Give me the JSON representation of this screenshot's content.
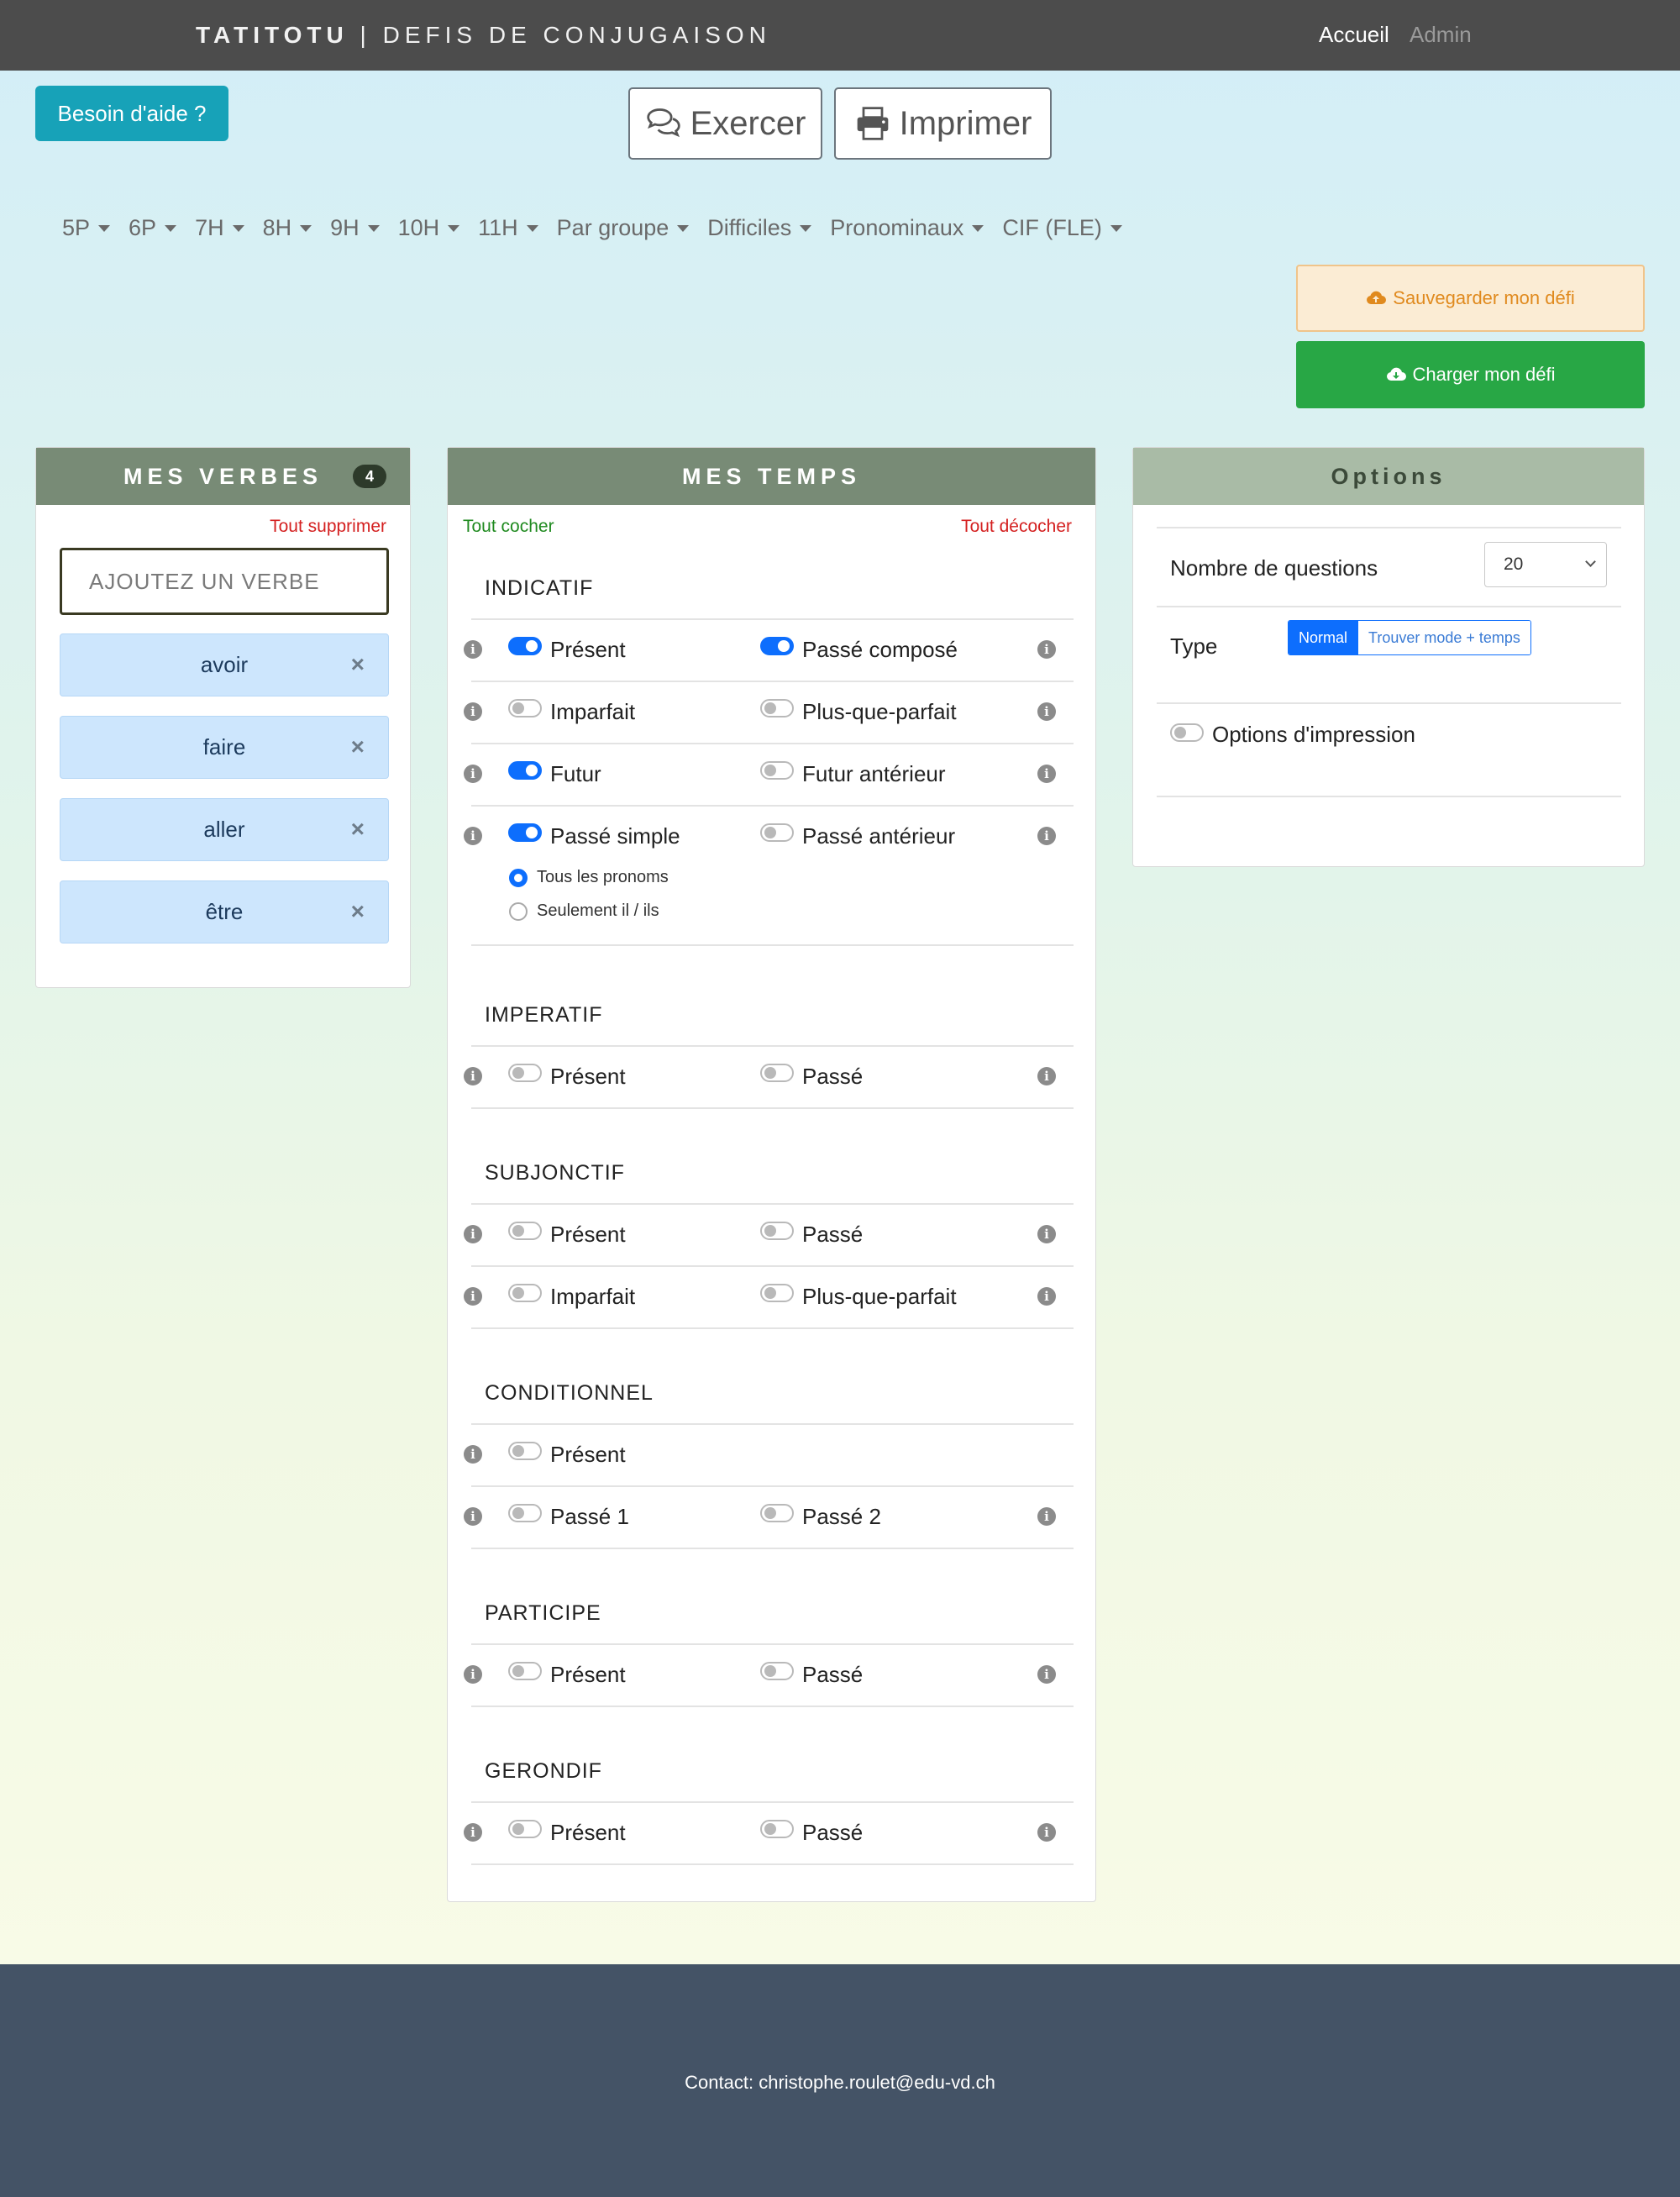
{
  "navbar": {
    "brand_bold": "TATITOTU",
    "brand_sep": " | ",
    "brand_rest": "DEFIS DE CONJUGAISON",
    "links": [
      "Accueil",
      "Admin"
    ]
  },
  "actions": {
    "help": "Besoin d'aide ?",
    "exercer": "Exercer",
    "imprimer": "Imprimer",
    "save": "Sauvegarder mon défi",
    "load": "Charger mon défi"
  },
  "grades": [
    "5P",
    "6P",
    "7H",
    "8H",
    "9H",
    "10H",
    "11H",
    "Par groupe",
    "Difficiles",
    "Pronominaux",
    "CIF (FLE)"
  ],
  "verbes": {
    "title": "MES VERBES",
    "count": "4",
    "clear_all": "Tout supprimer",
    "input_placeholder": "AJOUTEZ UN VERBE",
    "items": [
      "avoir",
      "faire",
      "aller",
      "être"
    ],
    "remove_symbol": "×"
  },
  "temps": {
    "title": "MES TEMPS",
    "check_all": "Tout cocher",
    "uncheck_all": "Tout décocher",
    "sections": [
      {
        "title": "INDICATIF",
        "rows": [
          {
            "left": "Présent",
            "left_on": true,
            "right": "Passé composé",
            "right_on": true
          },
          {
            "left": "Imparfait",
            "left_on": false,
            "right": "Plus-que-parfait",
            "right_on": false
          },
          {
            "left": "Futur",
            "left_on": true,
            "right": "Futur antérieur",
            "right_on": false
          },
          {
            "left": "Passé simple",
            "left_on": true,
            "right": "Passé antérieur",
            "right_on": false
          }
        ],
        "radios": [
          {
            "label": "Tous les pronoms",
            "selected": true
          },
          {
            "label": "Seulement il / ils",
            "selected": false
          }
        ]
      },
      {
        "title": "IMPERATIF",
        "rows": [
          {
            "left": "Présent",
            "left_on": false,
            "right": "Passé",
            "right_on": false
          }
        ]
      },
      {
        "title": "SUBJONCTIF",
        "rows": [
          {
            "left": "Présent",
            "left_on": false,
            "right": "Passé",
            "right_on": false
          },
          {
            "left": "Imparfait",
            "left_on": false,
            "right": "Plus-que-parfait",
            "right_on": false
          }
        ]
      },
      {
        "title": "CONDITIONNEL",
        "rows": [
          {
            "left": "Présent",
            "left_on": false
          },
          {
            "left": "Passé 1",
            "left_on": false,
            "right": "Passé 2",
            "right_on": false
          }
        ]
      },
      {
        "title": "PARTICIPE",
        "rows": [
          {
            "left": "Présent",
            "left_on": false,
            "right": "Passé",
            "right_on": false
          }
        ]
      },
      {
        "title": "GERONDIF",
        "rows": [
          {
            "left": "Présent",
            "left_on": false,
            "right": "Passé",
            "right_on": false
          }
        ]
      }
    ]
  },
  "options": {
    "title": "Options",
    "questions_label": "Nombre de questions",
    "questions_value": "20",
    "type_label": "Type",
    "type_options": [
      "Normal",
      "Trouver mode + temps"
    ],
    "type_selected": "Normal",
    "print_options": "Options d'impression",
    "print_on": false
  },
  "footer": {
    "contact": "Contact: christophe.roulet@edu-vd.ch"
  },
  "colors": {
    "navbar": "#4c4c4c",
    "help": "#17a2b8",
    "card_head": "#788b76",
    "options_head": "#a9bba6",
    "toggle_on": "#0d6efd",
    "load": "#28a745",
    "footer": "#445366"
  },
  "icons": {
    "info": "info-circle-icon",
    "toggle": "switch",
    "exercer": "comments-icon",
    "imprimer": "print-icon",
    "save": "cloud-upload-icon",
    "load": "cloud-download-icon"
  }
}
